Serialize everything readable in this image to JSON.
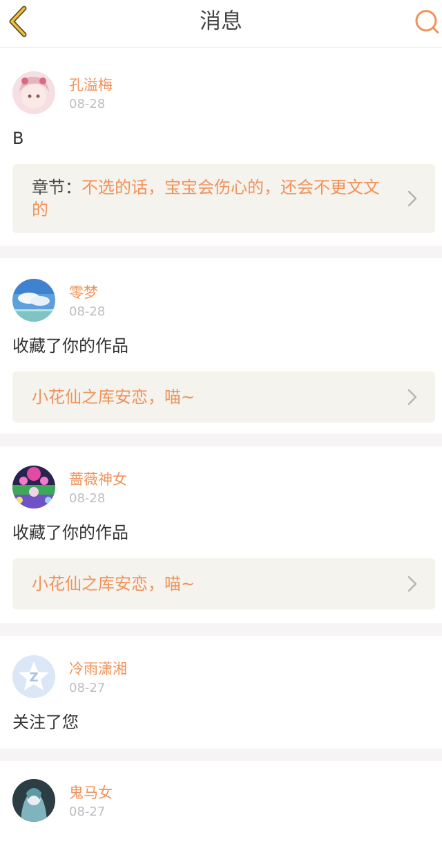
{
  "header": {
    "title": "消息",
    "back_icon": "chevron-left-icon",
    "search_icon": "search-icon",
    "accent": "#f0925a"
  },
  "messages": [
    {
      "user": "孔溢梅",
      "date": "08-28",
      "text": "B",
      "ref_label": "章节：",
      "ref_value": "不选的话，宝宝会伤心的，还会不更文文的"
    },
    {
      "user": "零梦",
      "date": "08-28",
      "text": "收藏了你的作品",
      "ref_label": "",
      "ref_value": "小花仙之库安恋，喵~"
    },
    {
      "user": "蔷薇神女",
      "date": "08-28",
      "text": "收藏了你的作品",
      "ref_label": "",
      "ref_value": "小花仙之库安恋，喵~"
    },
    {
      "user": "冷雨潇湘",
      "date": "08-27",
      "text": "关注了您"
    },
    {
      "user": "鬼马女",
      "date": "08-27"
    }
  ]
}
